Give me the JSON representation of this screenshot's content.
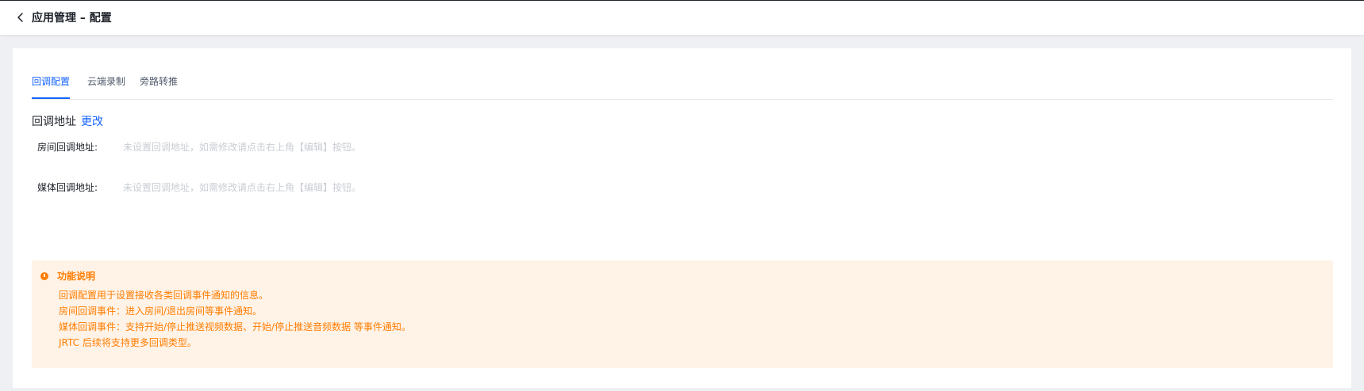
{
  "header": {
    "title": "应用管理 – 配置",
    "back_icon": "chevron-left-icon"
  },
  "tabs": [
    {
      "label": "回调配置",
      "active": true
    },
    {
      "label": "云端录制",
      "active": false
    },
    {
      "label": "旁路转推",
      "active": false
    }
  ],
  "callback": {
    "title": "回调地址",
    "edit_label": "更改",
    "fields": [
      {
        "label": "房间回调地址:",
        "placeholder": "未设置回调地址，如需修改请点击右上角【编辑】按钮。"
      },
      {
        "label": "媒体回调地址:",
        "placeholder": "未设置回调地址，如需修改请点击右上角【编辑】按钮。"
      }
    ]
  },
  "notice": {
    "icon": "warning-circle-icon",
    "title": "功能说明",
    "lines": [
      "回调配置用于设置接收各类回调事件通知的信息。",
      "房间回调事件：进入房间/退出房间等事件通知。",
      "媒体回调事件：支持开始/停止推送视频数据、开始/停止推送音频数据 等事件通知。",
      "JRTC 后续将支持更多回调类型。"
    ]
  },
  "colors": {
    "accent": "#1664ff",
    "warning": "#ff7d00",
    "notice_bg": "#fff3e8"
  }
}
